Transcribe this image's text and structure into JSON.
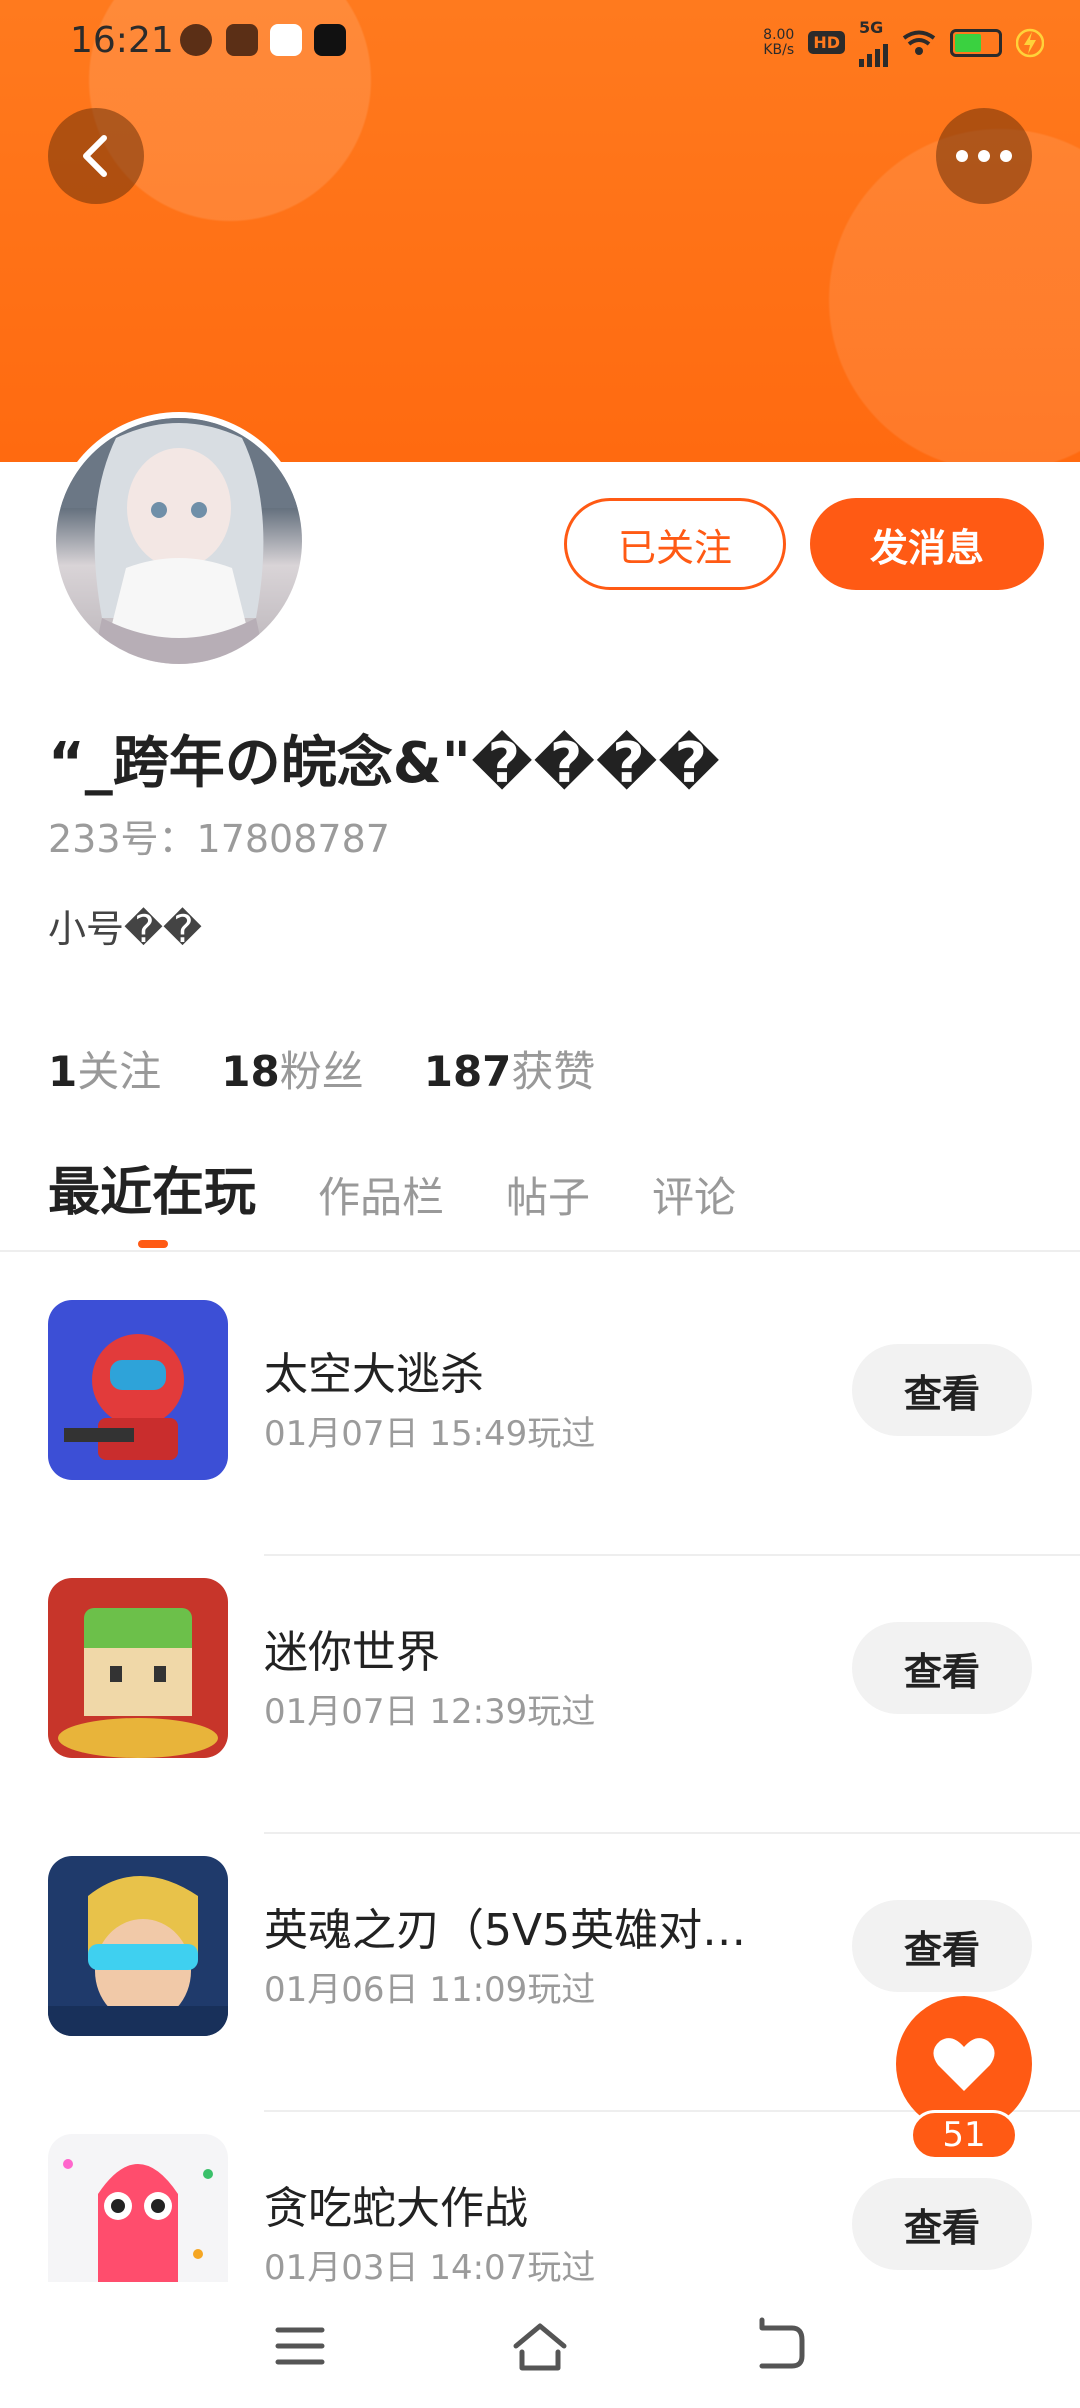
{
  "status_bar": {
    "time": "16:21",
    "net_speed_value": "8.00",
    "net_speed_unit": "KB/s",
    "hd": "HD",
    "network": "5G"
  },
  "header": {
    "back_icon": "chevron-left-icon",
    "more_icon": "more-dots-icon"
  },
  "profile": {
    "nickname": "“_跨年の皖念&\"����",
    "uid": "233号：17808787",
    "bio": "小号��",
    "follow_label": "已关注",
    "message_label": "发消息",
    "stats": [
      {
        "value": "1",
        "label": "关注"
      },
      {
        "value": "18",
        "label": "粉丝"
      },
      {
        "value": "187",
        "label": "获赞"
      }
    ]
  },
  "tabs": [
    {
      "label": "最近在玩"
    },
    {
      "label": "作品栏"
    },
    {
      "label": "帖子"
    },
    {
      "label": "评论"
    }
  ],
  "games": [
    {
      "name": "太空大逃杀",
      "time": "01月07日 15:49玩过",
      "action": "查看"
    },
    {
      "name": "迷你世界",
      "time": "01月07日 12:39玩过",
      "action": "查看"
    },
    {
      "name": "英魂之刃（5V5英雄对…",
      "time": "01月06日 11:09玩过",
      "action": "查看"
    },
    {
      "name": "贪吃蛇大作战",
      "time": "01月03日 14:07玩过",
      "action": "查看"
    }
  ],
  "like": {
    "count": "51"
  },
  "colors": {
    "accent": "#ff5a14",
    "header": "#ff7a1e"
  }
}
